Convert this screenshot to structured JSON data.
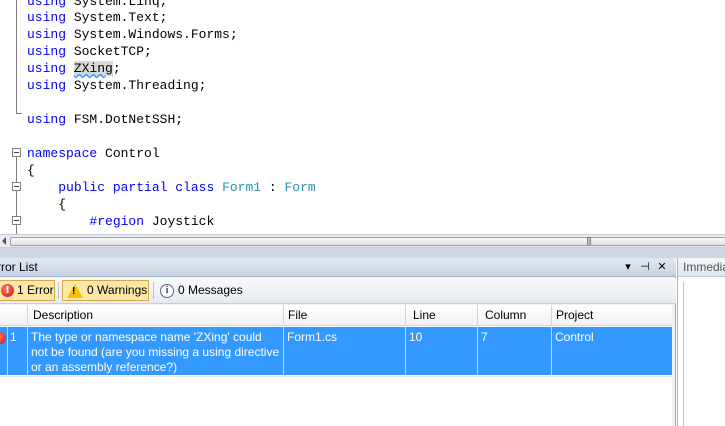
{
  "editor": {
    "lines": [
      {
        "kw": "using",
        "rest": "System.Linq;"
      },
      {
        "kw": "using",
        "rest": "System.Text;"
      },
      {
        "kw": "using",
        "rest": "System.Windows.Forms;"
      },
      {
        "kw": "using",
        "rest": "SocketTCP;"
      },
      {
        "kw": "using",
        "hl": "ZXing",
        "rest": ";"
      },
      {
        "kw": "using",
        "rest": "System.Threading;"
      },
      {
        "kw": "using",
        "rest": "FSM.DotNetSSH;"
      },
      {
        "kw": "namespace",
        "rest": "Control"
      },
      {
        "text": "{"
      },
      {
        "kw": "public partial class",
        "type1": "Form1",
        "mid": " : ",
        "type2": "Form"
      },
      {
        "text": "{"
      },
      {
        "kw": "#region",
        "rest": "Joystick"
      }
    ]
  },
  "error_list": {
    "title": "rror List",
    "filters": {
      "errors": "1 Error",
      "warnings": "0 Warnings",
      "messages": "0 Messages"
    },
    "columns": [
      "Description",
      "File",
      "Line",
      "Column",
      "Project"
    ],
    "rows": [
      {
        "index": "1",
        "description": "The type or namespace name 'ZXing' could not be found (are you missing a using directive or an assembly reference?)",
        "file": "Form1.cs",
        "line": "10",
        "column": "7",
        "project": "Control"
      }
    ]
  },
  "immediate": {
    "title": "Immediate Window"
  },
  "colors": {
    "keyword": "#0000ff",
    "type": "#2b91af",
    "selection": "#3399ff"
  }
}
